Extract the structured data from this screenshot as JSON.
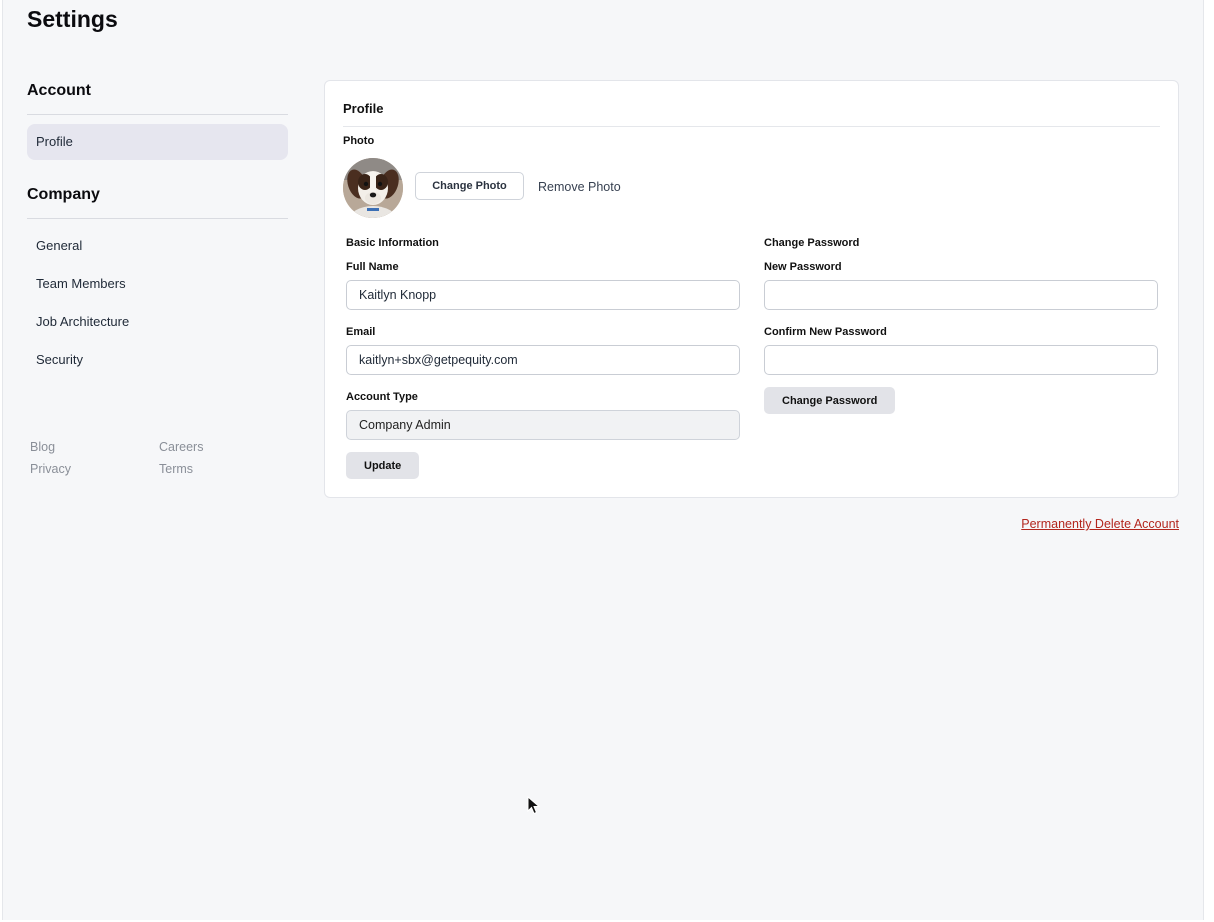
{
  "page": {
    "title": "Settings"
  },
  "sidebar": {
    "account_heading": "Account",
    "account_items": [
      {
        "label": "Profile",
        "active": true
      }
    ],
    "company_heading": "Company",
    "company_items": [
      {
        "label": "General"
      },
      {
        "label": "Team Members"
      },
      {
        "label": "Job Architecture"
      },
      {
        "label": "Security"
      }
    ],
    "footer_links": [
      "Blog",
      "Careers",
      "Privacy",
      "Terms"
    ]
  },
  "profile": {
    "title": "Profile",
    "photo_label": "Photo",
    "change_photo": "Change Photo",
    "remove_photo": "Remove Photo",
    "basic_info": {
      "heading": "Basic Information",
      "full_name_label": "Full Name",
      "full_name_value": "Kaitlyn Knopp",
      "email_label": "Email",
      "email_value": "kaitlyn+sbx@getpequity.com",
      "account_type_label": "Account Type",
      "account_type_value": "Company Admin",
      "update_button": "Update"
    },
    "change_password": {
      "heading": "Change Password",
      "new_password_label": "New Password",
      "new_password_value": "",
      "confirm_label": "Confirm New Password",
      "confirm_value": "",
      "button": "Change Password"
    }
  },
  "danger": {
    "delete_account": "Permanently Delete Account"
  },
  "colors": {
    "danger": "#b3261e",
    "active_nav_bg": "#e6e6ef",
    "page_bg": "#f6f7f9"
  }
}
